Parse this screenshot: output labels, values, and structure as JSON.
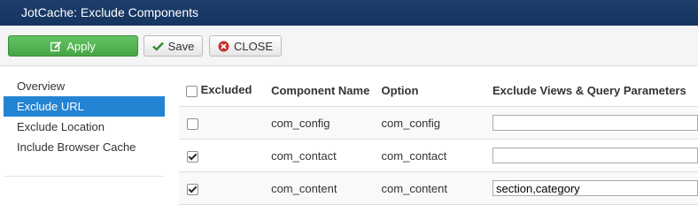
{
  "window": {
    "title": "JotCache: Exclude Components"
  },
  "toolbar": {
    "apply_label": "Apply",
    "save_label": "Save",
    "close_label": "CLOSE"
  },
  "sidebar": {
    "items": [
      {
        "label": "Overview",
        "active": false
      },
      {
        "label": "Exclude URL",
        "active": true
      },
      {
        "label": "Exclude Location",
        "active": false
      },
      {
        "label": "Include Browser Cache",
        "active": false
      }
    ]
  },
  "table": {
    "headers": {
      "excluded": "Excluded",
      "component": "Component Name",
      "option": "Option",
      "views": "Exclude Views & Query Parameters"
    },
    "rows": [
      {
        "checked": false,
        "component": "com_config",
        "option": "com_config",
        "value": ""
      },
      {
        "checked": true,
        "component": "com_contact",
        "option": "com_contact",
        "value": ""
      },
      {
        "checked": true,
        "component": "com_content",
        "option": "com_content",
        "value": "section,category"
      }
    ]
  },
  "colors": {
    "titlebar": "#1d3d6b",
    "apply_green": "#51b351",
    "active_blue": "#2384d3",
    "close_red": "#c9302c"
  }
}
